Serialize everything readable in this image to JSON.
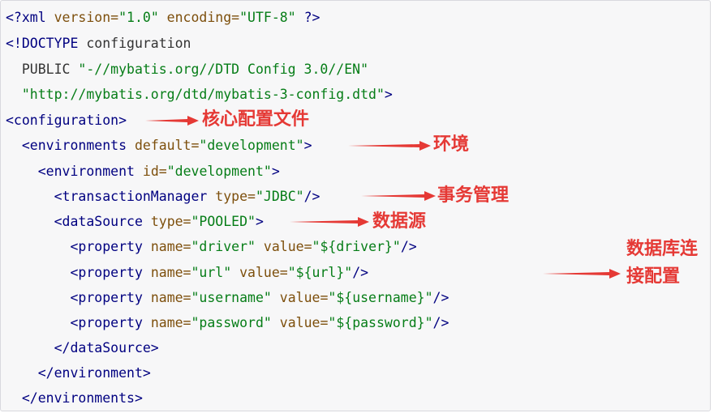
{
  "code": {
    "l1": {
      "a": "<?xml",
      "b": " version=",
      "c": "\"1.0\"",
      "d": " encoding=",
      "e": "\"UTF-8\"",
      "f": " ?>"
    },
    "l2": {
      "a": "<!DOCTYPE",
      "b": " configuration"
    },
    "l3": {
      "a": "  PUBLIC ",
      "b": "\"-//mybatis.org//DTD Config 3.0//EN\""
    },
    "l4": {
      "a": "  \"http://mybatis.org/dtd/mybatis-3-config.dtd\"",
      "b": ">"
    },
    "l5": {
      "a": "<configuration>"
    },
    "l6": {
      "a": "  <environments",
      "b": " default=",
      "c": "\"development\"",
      "d": ">"
    },
    "l7": {
      "a": "    <environment",
      "b": " id=",
      "c": "\"development\"",
      "d": ">"
    },
    "l8": {
      "a": "      <transactionManager",
      "b": " type=",
      "c": "\"JDBC\"",
      "d": "/>"
    },
    "l9": {
      "a": "      <dataSource",
      "b": " type=",
      "c": "\"POOLED\"",
      "d": ">"
    },
    "l10": {
      "a": "        <property",
      "b": " name=",
      "c": "\"driver\"",
      "d": " value=",
      "e": "\"${driver}\"",
      "f": "/>"
    },
    "l11": {
      "a": "        <property",
      "b": " name=",
      "c": "\"url\"",
      "d": " value=",
      "e": "\"${url}\"",
      "f": "/>"
    },
    "l12": {
      "a": "        <property",
      "b": " name=",
      "c": "\"username\"",
      "d": " value=",
      "e": "\"${username}\"",
      "f": "/>"
    },
    "l13": {
      "a": "        <property",
      "b": " name=",
      "c": "\"password\"",
      "d": " value=",
      "e": "\"${password}\"",
      "f": "/>"
    },
    "l14": {
      "a": "      </dataSource>"
    },
    "l15": {
      "a": "    </environment>"
    },
    "l16": {
      "a": "  </environments>"
    }
  },
  "annotations": {
    "config_file": "核心配置文件",
    "environment": "环境",
    "transaction": "事务管理",
    "datasource": "数据源",
    "db_connection": "数据库连接配置"
  },
  "colors": {
    "annotation": "#e53935",
    "tag": "#000080",
    "attribute": "#7d4f0c",
    "value": "#067d17"
  }
}
